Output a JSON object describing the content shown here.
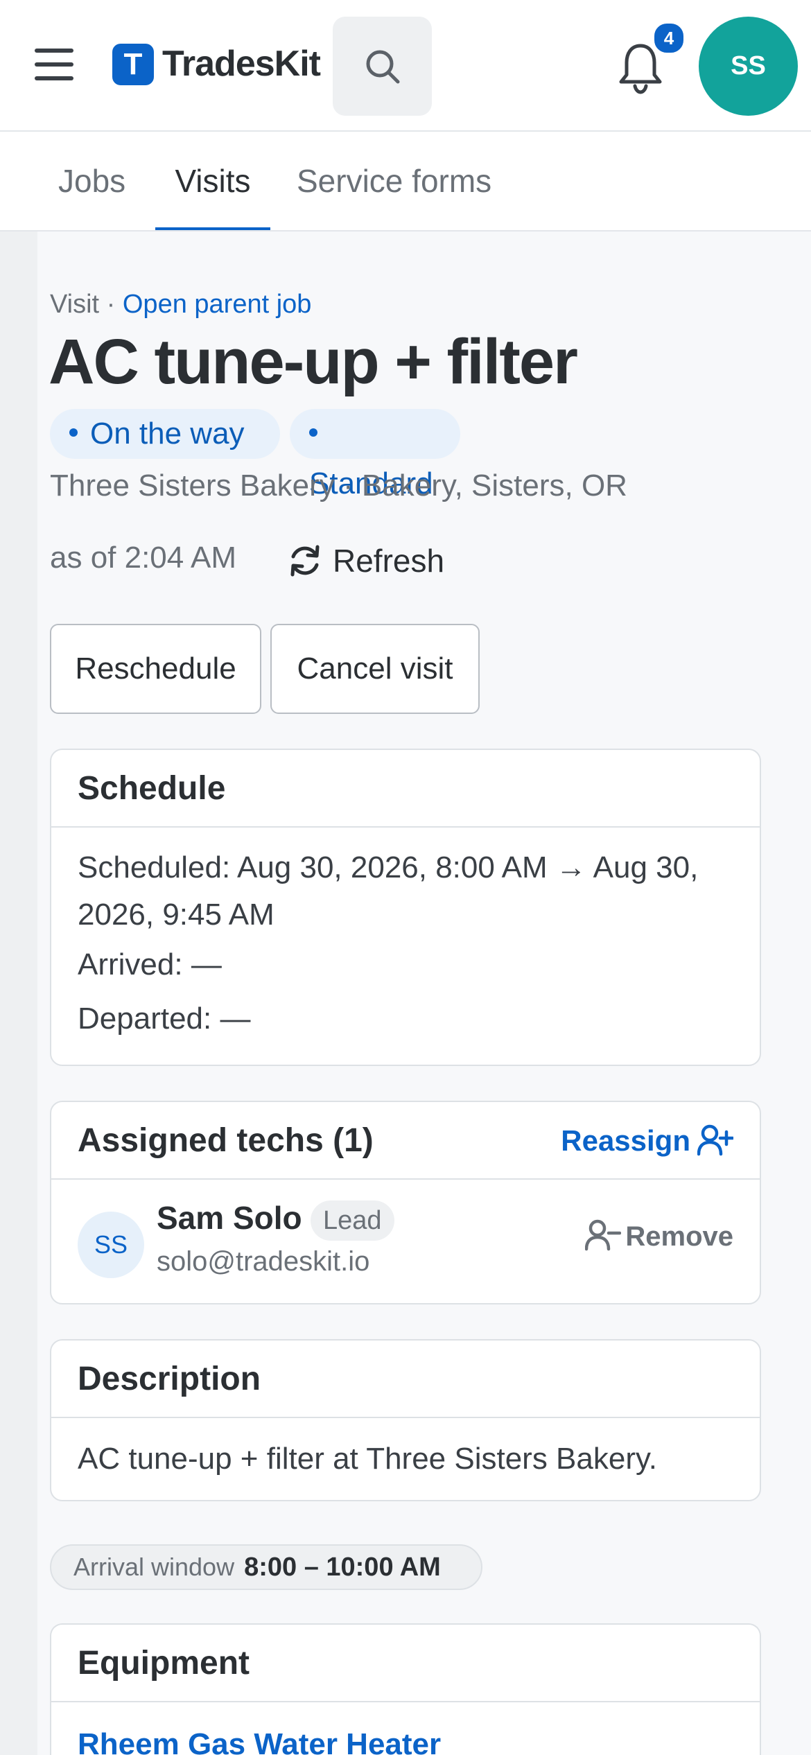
{
  "header": {
    "brand_initial": "T",
    "brand_name": "TradesKit",
    "notification_count": "4",
    "user_initials": "SS"
  },
  "tabs": [
    {
      "label": "Jobs"
    },
    {
      "label": "Visits",
      "active": true
    },
    {
      "label": "Service forms"
    }
  ],
  "visit": {
    "breadcrumb_prefix": "Visit · ",
    "breadcrumb_link": "Open parent job",
    "title": "AC tune-up + filter",
    "status": "On the way",
    "type": "Standard",
    "customer_line": "Three Sisters Bakery · Bakery, Sisters, OR",
    "as_of": "as of 2:04 AM",
    "refresh_label": "Refresh"
  },
  "actions": {
    "reschedule": "Reschedule",
    "cancel": "Cancel visit"
  },
  "schedule": {
    "heading": "Schedule",
    "scheduled": "Scheduled: Aug 30, 2026, 8:00 AM → Aug 30, 2026, 9:45 AM",
    "arrived": "Arrived: —",
    "departed": "Departed: —"
  },
  "techs": {
    "heading": "Assigned techs (1)",
    "reassign": "Reassign",
    "items": [
      {
        "initials": "SS",
        "name": "Sam Solo",
        "role": "Lead",
        "email": "solo@tradeskit.io",
        "remove": "Remove"
      }
    ]
  },
  "description": {
    "heading": "Description",
    "text": "AC tune-up + filter at Three Sisters Bakery."
  },
  "arrival_window": {
    "label": "Arrival window",
    "value": "8:00 – 10:00 AM"
  },
  "equipment": {
    "heading": "Equipment",
    "items": [
      {
        "name": "Rheem Gas Water Heater"
      }
    ]
  },
  "colors": {
    "accent": "#0b63c8",
    "avatar": "#12a39b",
    "chip_bg": "#e8f1fb"
  }
}
